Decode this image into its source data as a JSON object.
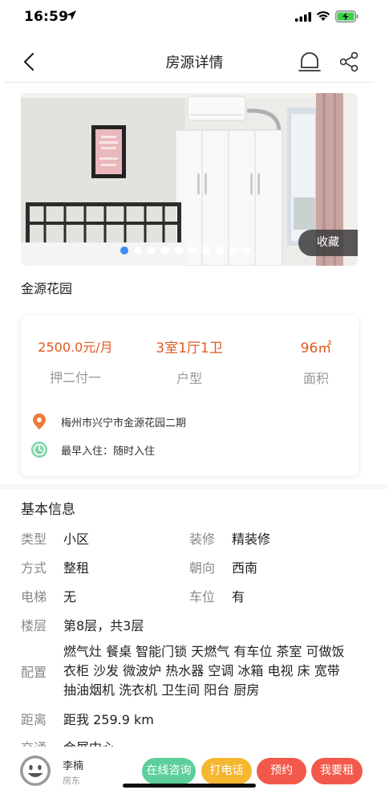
{
  "status_bar": {
    "time": "16:59"
  },
  "nav": {
    "title": "房源详情"
  },
  "gallery": {
    "favorite_label": "收藏",
    "total_images": 10,
    "current_index": 1
  },
  "property": {
    "name": "金源花园"
  },
  "summary": {
    "price": "2500.0元/月",
    "payment": "押二付一",
    "layout": "3室1厅1卫",
    "layout_label": "户型",
    "area": "96㎡",
    "area_label": "面积",
    "address": "梅州市兴宁市金源花园二期",
    "move_in": "最早入住：随时入住"
  },
  "basic_info": {
    "title": "基本信息",
    "type_label": "类型",
    "type_value": "小区",
    "decor_label": "装修",
    "decor_value": "精装修",
    "mode_label": "方式",
    "mode_value": "整租",
    "orient_label": "朝向",
    "orient_value": "西南",
    "elevator_label": "电梯",
    "elevator_value": "无",
    "parking_label": "车位",
    "parking_value": "有",
    "floor_label": "楼层",
    "floor_value": "第8层，共3层",
    "config_label": "配置",
    "config_lines": [
      "燃气灶 餐桌 智能门锁 天燃气 有车位 茶室  可做饭",
      "衣柜 沙发 微波炉 热水器 空调 冰箱 电视 床 宽带",
      "抽油烟机 洗衣机 卫生间 阳台 厨房"
    ],
    "distance_label": "距离",
    "distance_value": "距我 259.9 km",
    "traffic_label": "交通",
    "traffic_value": "会展中心"
  },
  "agent": {
    "name": "李楠",
    "role": "房东"
  },
  "actions": {
    "consult": "在线咨询",
    "call": "打电话",
    "book": "预约",
    "rent": "我要租"
  },
  "colors": {
    "accent_orange": "#e0591f",
    "dot_active": "#3f8cf5",
    "green": "#5ccf9a",
    "yellow": "#f5b730",
    "red": "#f3594a"
  },
  "icons": [
    "location-pin-icon",
    "clock-icon",
    "bell-icon",
    "share-icon",
    "back-arrow-icon",
    "smiley-avatar-icon"
  ]
}
